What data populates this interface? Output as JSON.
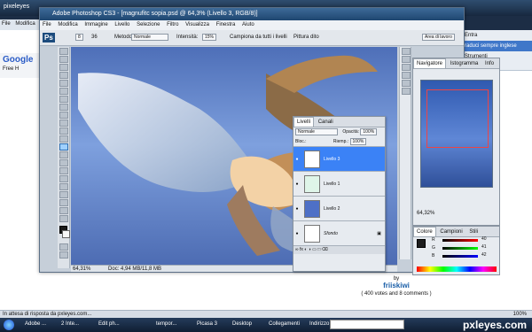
{
  "browser": {
    "title_left": "pixeleyes",
    "menu_items": [
      "File",
      "Modifica"
    ],
    "google_label": "Google",
    "google_text": "Free H",
    "right_sidebar": [
      "Entra",
      "raduci sempre inglese",
      "Strumenti"
    ],
    "status_text": "In attesa di risposta da pxleyes.com...",
    "zoom_level": "100%"
  },
  "photoshop": {
    "window_title": "Adobe Photoshop CS3 - [magnufitc sopia.psd @ 64,3% (Livello 3, RGB/8)]",
    "logo": "Ps",
    "menu": [
      "File",
      "Modifica",
      "Immagine",
      "Livello",
      "Selezione",
      "Filtro",
      "Visualizza",
      "Finestra",
      "Aiuto"
    ],
    "options": {
      "brush_size": "8",
      "brush_size_label": "36",
      "method_label": "Metodo:",
      "method_value": "Normale",
      "intensity_label": "Intensità:",
      "intensity_value": "15%",
      "sample_all": "Campiona da tutti i livelli",
      "finger_paint": "Pittura dito",
      "workspace": "Area di lavoro"
    },
    "canvas_status": "Doc: 4,94 MB/11,8 MB",
    "zoom": "64,31%"
  },
  "layers_panel": {
    "tabs": [
      "Livelli",
      "Canali"
    ],
    "mode": "Normale",
    "opacity_label": "Opacità:",
    "opacity": "100%",
    "lock_label": "Bloc.:",
    "fill_label": "Riemp.:",
    "fill": "100%",
    "layers": [
      {
        "name": "Livello 3",
        "selected": true
      },
      {
        "name": "Livello 1",
        "selected": false
      },
      {
        "name": "Livello 2",
        "selected": false
      },
      {
        "name": "Sfondo",
        "selected": false
      }
    ]
  },
  "navigator": {
    "tabs": [
      "Navigatore",
      "Istogramma",
      "Info"
    ],
    "zoom": "64,32%"
  },
  "color_panel": {
    "tabs": [
      "Colore",
      "Campioni",
      "Stili"
    ],
    "channels": [
      {
        "label": "R",
        "value": "40"
      },
      {
        "label": "G",
        "value": "41"
      },
      {
        "label": "B",
        "value": "42"
      }
    ]
  },
  "blog": {
    "by": "by",
    "author": "friiskiwi",
    "votes_text": "( 400 votes and 8 comments )"
  },
  "taskbar": {
    "items": [
      "Adobe ...",
      "2 Inte...",
      "Edit ph...",
      "tempor...",
      "Picasa 3",
      "Desktop",
      "Collegamenti",
      "Indirizzo"
    ],
    "brand": "pxleyes.com"
  },
  "colors": {
    "accent": "#3b82f6",
    "brand": "#1b5fa8"
  }
}
